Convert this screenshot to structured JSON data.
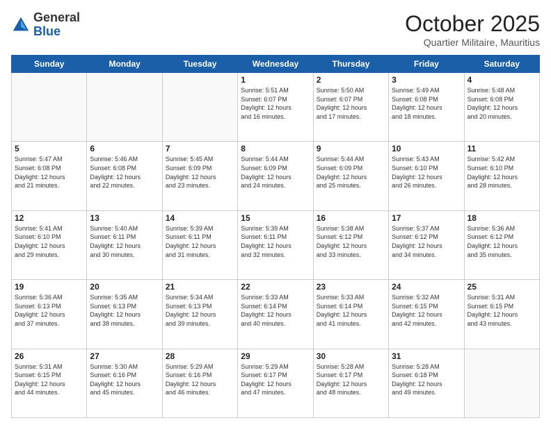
{
  "header": {
    "logo_line1": "General",
    "logo_line2": "Blue",
    "month": "October 2025",
    "location": "Quartier Militaire, Mauritius"
  },
  "days_of_week": [
    "Sunday",
    "Monday",
    "Tuesday",
    "Wednesday",
    "Thursday",
    "Friday",
    "Saturday"
  ],
  "weeks": [
    [
      {
        "day": "",
        "info": ""
      },
      {
        "day": "",
        "info": ""
      },
      {
        "day": "",
        "info": ""
      },
      {
        "day": "1",
        "info": "Sunrise: 5:51 AM\nSunset: 6:07 PM\nDaylight: 12 hours\nand 16 minutes."
      },
      {
        "day": "2",
        "info": "Sunrise: 5:50 AM\nSunset: 6:07 PM\nDaylight: 12 hours\nand 17 minutes."
      },
      {
        "day": "3",
        "info": "Sunrise: 5:49 AM\nSunset: 6:08 PM\nDaylight: 12 hours\nand 18 minutes."
      },
      {
        "day": "4",
        "info": "Sunrise: 5:48 AM\nSunset: 6:08 PM\nDaylight: 12 hours\nand 20 minutes."
      }
    ],
    [
      {
        "day": "5",
        "info": "Sunrise: 5:47 AM\nSunset: 6:08 PM\nDaylight: 12 hours\nand 21 minutes."
      },
      {
        "day": "6",
        "info": "Sunrise: 5:46 AM\nSunset: 6:08 PM\nDaylight: 12 hours\nand 22 minutes."
      },
      {
        "day": "7",
        "info": "Sunrise: 5:45 AM\nSunset: 6:09 PM\nDaylight: 12 hours\nand 23 minutes."
      },
      {
        "day": "8",
        "info": "Sunrise: 5:44 AM\nSunset: 6:09 PM\nDaylight: 12 hours\nand 24 minutes."
      },
      {
        "day": "9",
        "info": "Sunrise: 5:44 AM\nSunset: 6:09 PM\nDaylight: 12 hours\nand 25 minutes."
      },
      {
        "day": "10",
        "info": "Sunrise: 5:43 AM\nSunset: 6:10 PM\nDaylight: 12 hours\nand 26 minutes."
      },
      {
        "day": "11",
        "info": "Sunrise: 5:42 AM\nSunset: 6:10 PM\nDaylight: 12 hours\nand 28 minutes."
      }
    ],
    [
      {
        "day": "12",
        "info": "Sunrise: 5:41 AM\nSunset: 6:10 PM\nDaylight: 12 hours\nand 29 minutes."
      },
      {
        "day": "13",
        "info": "Sunrise: 5:40 AM\nSunset: 6:11 PM\nDaylight: 12 hours\nand 30 minutes."
      },
      {
        "day": "14",
        "info": "Sunrise: 5:39 AM\nSunset: 6:11 PM\nDaylight: 12 hours\nand 31 minutes."
      },
      {
        "day": "15",
        "info": "Sunrise: 5:39 AM\nSunset: 6:11 PM\nDaylight: 12 hours\nand 32 minutes."
      },
      {
        "day": "16",
        "info": "Sunrise: 5:38 AM\nSunset: 6:12 PM\nDaylight: 12 hours\nand 33 minutes."
      },
      {
        "day": "17",
        "info": "Sunrise: 5:37 AM\nSunset: 6:12 PM\nDaylight: 12 hours\nand 34 minutes."
      },
      {
        "day": "18",
        "info": "Sunrise: 5:36 AM\nSunset: 6:12 PM\nDaylight: 12 hours\nand 35 minutes."
      }
    ],
    [
      {
        "day": "19",
        "info": "Sunrise: 5:36 AM\nSunset: 6:13 PM\nDaylight: 12 hours\nand 37 minutes."
      },
      {
        "day": "20",
        "info": "Sunrise: 5:35 AM\nSunset: 6:13 PM\nDaylight: 12 hours\nand 38 minutes."
      },
      {
        "day": "21",
        "info": "Sunrise: 5:34 AM\nSunset: 6:13 PM\nDaylight: 12 hours\nand 39 minutes."
      },
      {
        "day": "22",
        "info": "Sunrise: 5:33 AM\nSunset: 6:14 PM\nDaylight: 12 hours\nand 40 minutes."
      },
      {
        "day": "23",
        "info": "Sunrise: 5:33 AM\nSunset: 6:14 PM\nDaylight: 12 hours\nand 41 minutes."
      },
      {
        "day": "24",
        "info": "Sunrise: 5:32 AM\nSunset: 6:15 PM\nDaylight: 12 hours\nand 42 minutes."
      },
      {
        "day": "25",
        "info": "Sunrise: 5:31 AM\nSunset: 6:15 PM\nDaylight: 12 hours\nand 43 minutes."
      }
    ],
    [
      {
        "day": "26",
        "info": "Sunrise: 5:31 AM\nSunset: 6:15 PM\nDaylight: 12 hours\nand 44 minutes."
      },
      {
        "day": "27",
        "info": "Sunrise: 5:30 AM\nSunset: 6:16 PM\nDaylight: 12 hours\nand 45 minutes."
      },
      {
        "day": "28",
        "info": "Sunrise: 5:29 AM\nSunset: 6:16 PM\nDaylight: 12 hours\nand 46 minutes."
      },
      {
        "day": "29",
        "info": "Sunrise: 5:29 AM\nSunset: 6:17 PM\nDaylight: 12 hours\nand 47 minutes."
      },
      {
        "day": "30",
        "info": "Sunrise: 5:28 AM\nSunset: 6:17 PM\nDaylight: 12 hours\nand 48 minutes."
      },
      {
        "day": "31",
        "info": "Sunrise: 5:28 AM\nSunset: 6:18 PM\nDaylight: 12 hours\nand 49 minutes."
      },
      {
        "day": "",
        "info": ""
      }
    ]
  ]
}
